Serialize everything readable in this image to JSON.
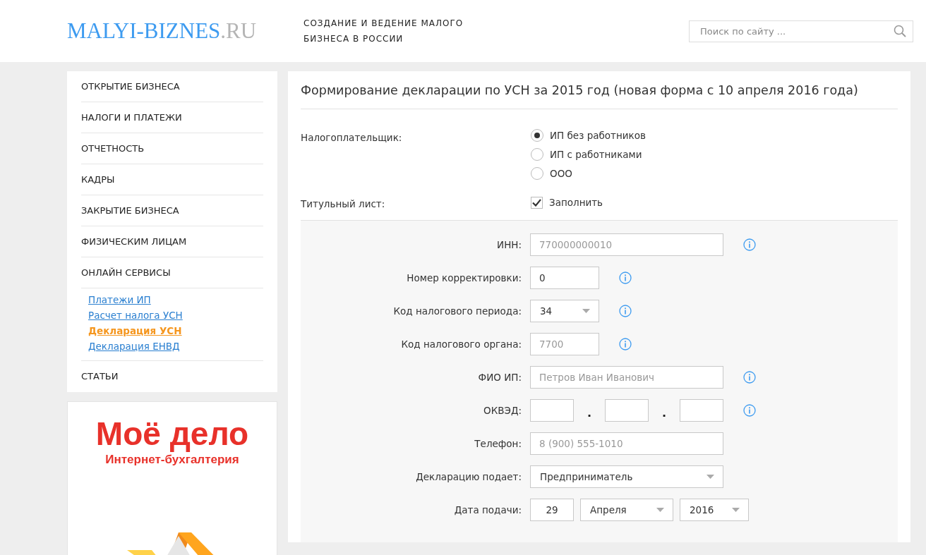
{
  "header": {
    "logo_main": "MALYI-BIZNES",
    "logo_suffix": ".RU",
    "tagline": "СОЗДАНИЕ И ВЕДЕНИЕ МАЛОГО БИЗНЕСА В РОССИИ",
    "search": {
      "placeholder": "Поиск по сайту ..."
    }
  },
  "sidebar": {
    "items": [
      {
        "label": "ОТКРЫТИЕ БИЗНЕСА"
      },
      {
        "label": "НАЛОГИ И ПЛАТЕЖИ"
      },
      {
        "label": "ОТЧЕТНОСТЬ"
      },
      {
        "label": "КАДРЫ"
      },
      {
        "label": "ЗАКРЫТИЕ БИЗНЕСА"
      },
      {
        "label": "ФИЗИЧЕСКИМ ЛИЦАМ"
      },
      {
        "label": "ОНЛАЙН СЕРВИСЫ",
        "children": [
          {
            "label": "Платежи ИП",
            "selected": false
          },
          {
            "label": "Расчет налога УСН",
            "selected": false
          },
          {
            "label": "Декларация УСН",
            "selected": true
          },
          {
            "label": "Декларация ЕНВД",
            "selected": false
          }
        ]
      },
      {
        "label": "СТАТЬИ"
      }
    ]
  },
  "ad": {
    "brand": "Моё дело",
    "subtitle": "Интернет-бухгалтерия",
    "kind": "picture"
  },
  "main": {
    "title": "Формирование декларации по УСН за 2015 год (новая форма с 10 апреля 2016 года)",
    "taxpayer": {
      "label": "Налогоплательщик:",
      "options": [
        {
          "label": "ИП без работников",
          "selected": true
        },
        {
          "label": "ИП с работниками",
          "selected": false
        },
        {
          "label": "ООО",
          "selected": false
        }
      ]
    },
    "title_page": {
      "label": "Титульный лист:",
      "checkbox": {
        "label": "Заполнить",
        "checked": true
      }
    },
    "fields": [
      {
        "kind": "text",
        "label": "ИНН:",
        "placeholder": "770000000010",
        "info": true
      },
      {
        "kind": "short-text",
        "label": "Номер корректировки:",
        "value": "0",
        "info": true
      },
      {
        "kind": "short-select",
        "label": "Код налогового периода:",
        "value": "34",
        "info": true
      },
      {
        "kind": "short-text",
        "label": "Код налогового органа:",
        "placeholder": "7700",
        "info": true
      },
      {
        "kind": "text",
        "label": "ФИО ИП:",
        "placeholder": "Петров Иван Иванович",
        "info": true
      },
      {
        "kind": "okved",
        "label": "ОКВЭД:",
        "separators": [
          ".",
          "."
        ],
        "info": true
      },
      {
        "kind": "text",
        "label": "Телефон:",
        "placeholder": "8 (900) 555-1010",
        "info": false
      },
      {
        "kind": "select",
        "label": "Декларацию подает:",
        "value": "Предприниматель",
        "info": false
      },
      {
        "kind": "date",
        "label": "Дата подачи:",
        "day": "29",
        "month": "Апреля",
        "year": "2016",
        "info": false
      }
    ]
  }
}
